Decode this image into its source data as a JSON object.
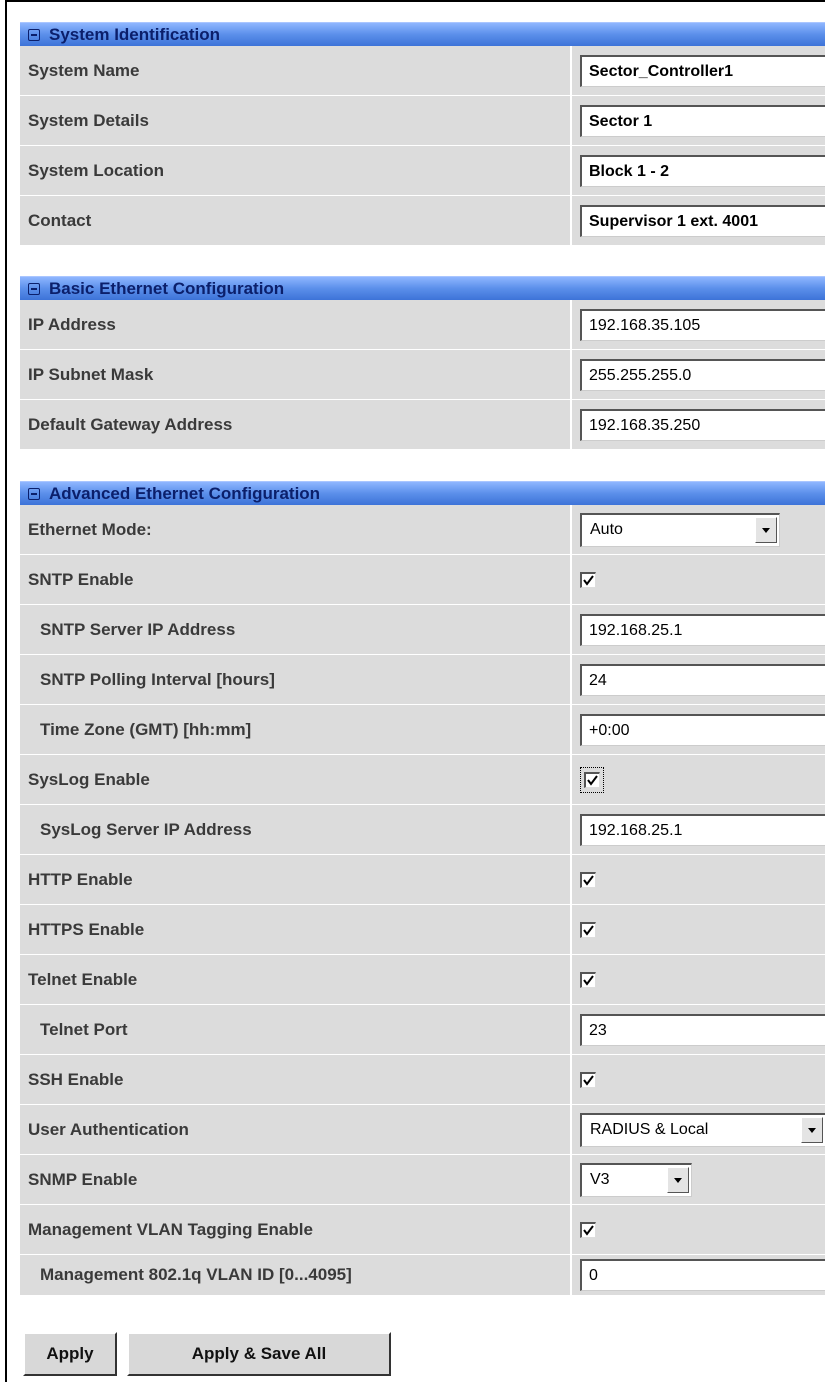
{
  "sections": {
    "system_identification": {
      "title": "System Identification",
      "system_name": {
        "label": "System Name",
        "value": "Sector_Controller1"
      },
      "system_details": {
        "label": "System Details",
        "value": "Sector 1"
      },
      "system_location": {
        "label": "System Location",
        "value": "Block 1 - 2"
      },
      "contact": {
        "label": "Contact",
        "value": "Supervisor 1 ext. 4001"
      }
    },
    "basic_ethernet": {
      "title": "Basic Ethernet Configuration",
      "ip_address": {
        "label": "IP Address",
        "value": "192.168.35.105"
      },
      "subnet_mask": {
        "label": "IP Subnet Mask",
        "value": "255.255.255.0"
      },
      "gateway": {
        "label": "Default Gateway Address",
        "value": "192.168.35.250"
      }
    },
    "advanced_ethernet": {
      "title": "Advanced Ethernet Configuration",
      "ethernet_mode": {
        "label": "Ethernet Mode:",
        "value": "Auto"
      },
      "sntp_enable": {
        "label": "SNTP Enable",
        "checked": true
      },
      "sntp_server": {
        "label": "SNTP Server IP Address",
        "value": "192.168.25.1"
      },
      "sntp_interval": {
        "label": "SNTP Polling Interval [hours]",
        "value": "24"
      },
      "time_zone": {
        "label": "Time Zone (GMT) [hh:mm]",
        "value": "+0:00"
      },
      "syslog_enable": {
        "label": "SysLog Enable",
        "checked": true
      },
      "syslog_server": {
        "label": "SysLog Server IP Address",
        "value": "192.168.25.1"
      },
      "http_enable": {
        "label": "HTTP Enable",
        "checked": true
      },
      "https_enable": {
        "label": "HTTPS Enable",
        "checked": true
      },
      "telnet_enable": {
        "label": "Telnet Enable",
        "checked": true
      },
      "telnet_port": {
        "label": "Telnet Port",
        "value": "23"
      },
      "ssh_enable": {
        "label": "SSH Enable",
        "checked": true
      },
      "user_auth": {
        "label": "User Authentication",
        "value": "RADIUS & Local"
      },
      "snmp_enable": {
        "label": "SNMP Enable",
        "value": "V3"
      },
      "mgmt_vlan_enable": {
        "label": "Management VLAN Tagging Enable",
        "checked": true
      },
      "mgmt_vlan_id": {
        "label": "Management 802.1q VLAN ID [0...4095]",
        "value": "0"
      }
    }
  },
  "buttons": {
    "apply": "Apply",
    "apply_save_all": "Apply & Save All"
  },
  "colors": {
    "header_gradient_top": "#8fb6ff",
    "header_gradient_bottom": "#3d73d8",
    "header_text": "#0b1f6b",
    "row_bg": "#dcdcdc"
  }
}
